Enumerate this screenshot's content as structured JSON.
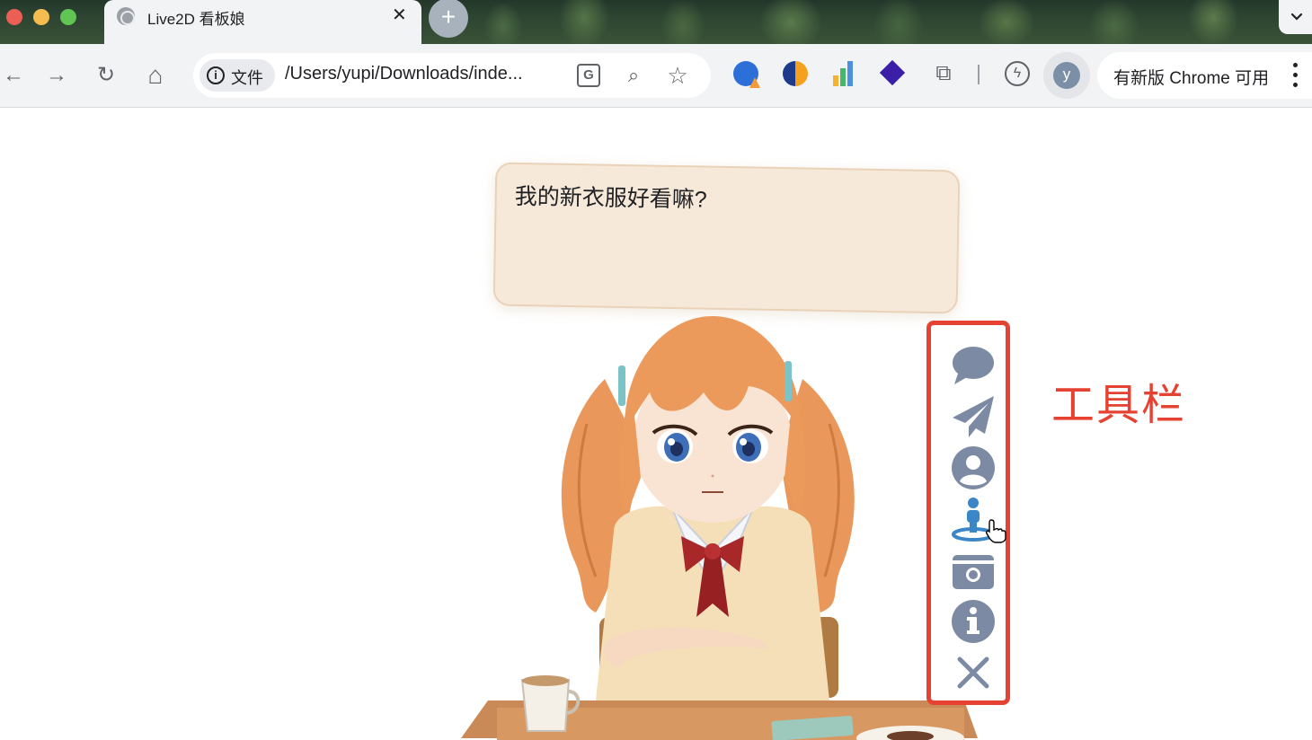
{
  "browser": {
    "tab": {
      "title": "Live2D 看板娘",
      "close_glyph": "✕"
    },
    "new_tab_glyph": "+",
    "tab_dropdown_glyph": "⌄",
    "nav": {
      "back_glyph": "←",
      "forward_glyph": "→",
      "reload_glyph": "↻",
      "home_glyph": "⌂"
    },
    "omnibox": {
      "site_chip_label": "文件",
      "info_glyph": "i",
      "url": "/Users/yupi/Downloads/inde...",
      "translate_glyph": "G",
      "zoom_glyph": "⌕",
      "bookmark_glyph": "☆"
    },
    "extensions": [
      "profile-alert-extension-icon",
      "half-circle-extension-icon",
      "bar-chart-extension-icon",
      "layers-extension-icon",
      "puzzle-icon",
      "bolt-circle-icon"
    ],
    "puzzle_glyph": "⧉",
    "bolt_glyph": "ϟ",
    "avatar_letter": "y",
    "update_text": "有新版 Chrome 可用"
  },
  "page": {
    "speech_text": "我的新衣服好看嘛?",
    "tools": [
      "chat-icon",
      "paper-plane-icon",
      "user-circle-icon",
      "street-view-icon",
      "camera-icon",
      "info-circle-icon",
      "close-icon"
    ],
    "tools_label": "工具栏",
    "colors": {
      "tool_gray": "#7c8ba3",
      "tool_active": "#3a86c6",
      "highlight_red": "#e64232",
      "speech_bg": "#f6e9da",
      "speech_border": "#ead2b8"
    }
  }
}
